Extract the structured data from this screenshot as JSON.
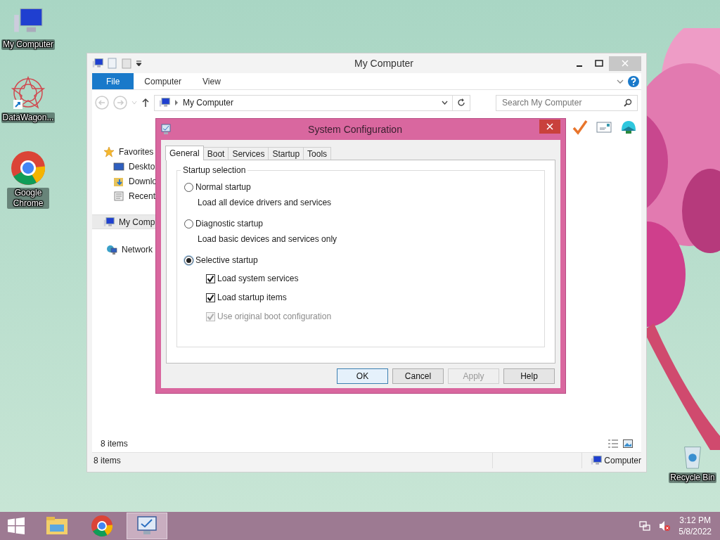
{
  "desktop_icons": [
    {
      "kind": "computer",
      "label": "My Computer"
    },
    {
      "kind": "datawagon",
      "label": "DataWagon..."
    },
    {
      "kind": "chrome",
      "label": "Google Chrome"
    },
    {
      "kind": "recycle",
      "label": "Recycle Bin"
    }
  ],
  "explorer": {
    "title": "My Computer",
    "ribbon_tabs": [
      {
        "label": "File",
        "selected": true
      },
      {
        "label": "Computer",
        "selected": false
      },
      {
        "label": "View",
        "selected": false
      }
    ],
    "address": "My Computer",
    "search": {
      "placeholder": "Search My Computer"
    },
    "nav_items": [
      {
        "kind": "favorites",
        "label": "Favorites",
        "selected": false,
        "children": [
          {
            "kind": "desktop",
            "label": "Deskto",
            "selected": false
          },
          {
            "kind": "downloads",
            "label": "Downlo",
            "selected": false
          },
          {
            "kind": "recent",
            "label": "Recent",
            "selected": false
          }
        ]
      },
      {
        "kind": "computer",
        "label": "My Comp",
        "selected": true
      },
      {
        "kind": "network",
        "label": "Network",
        "selected": false
      }
    ],
    "item_count": "8 items",
    "status_bar": {
      "items": "8 items",
      "location": "Computer"
    }
  },
  "dialog": {
    "title": "System Configuration",
    "tabs": [
      {
        "label": "General",
        "selected": true
      },
      {
        "label": "Boot",
        "selected": false
      },
      {
        "label": "Services",
        "selected": false
      },
      {
        "label": "Startup",
        "selected": false
      },
      {
        "label": "Tools",
        "selected": false
      }
    ],
    "group_label": "Startup selection",
    "options": [
      {
        "label": "Normal startup",
        "description": "Load all device drivers and services",
        "selected": false
      },
      {
        "label": "Diagnostic startup",
        "description": "Load basic devices and services only",
        "selected": false
      },
      {
        "label": "Selective startup",
        "selected": true,
        "checkboxes": [
          {
            "label": "Load system services",
            "checked": true,
            "disabled": false
          },
          {
            "label": "Load startup items",
            "checked": true,
            "disabled": false
          },
          {
            "label": "Use original boot configuration",
            "checked": true,
            "disabled": true
          }
        ]
      }
    ],
    "buttons": [
      {
        "label": "OK",
        "default": true,
        "disabled": false
      },
      {
        "label": "Cancel",
        "default": false,
        "disabled": false
      },
      {
        "label": "Apply",
        "default": false,
        "disabled": true
      },
      {
        "label": "Help",
        "default": false,
        "disabled": false
      }
    ]
  },
  "taskbar": {
    "apps": [
      {
        "kind": "explorer",
        "active": false
      },
      {
        "kind": "chrome",
        "active": false
      },
      {
        "kind": "msconfig",
        "active": true
      }
    ],
    "clock": {
      "time": "3:12 PM",
      "date": "5/8/2022"
    }
  }
}
